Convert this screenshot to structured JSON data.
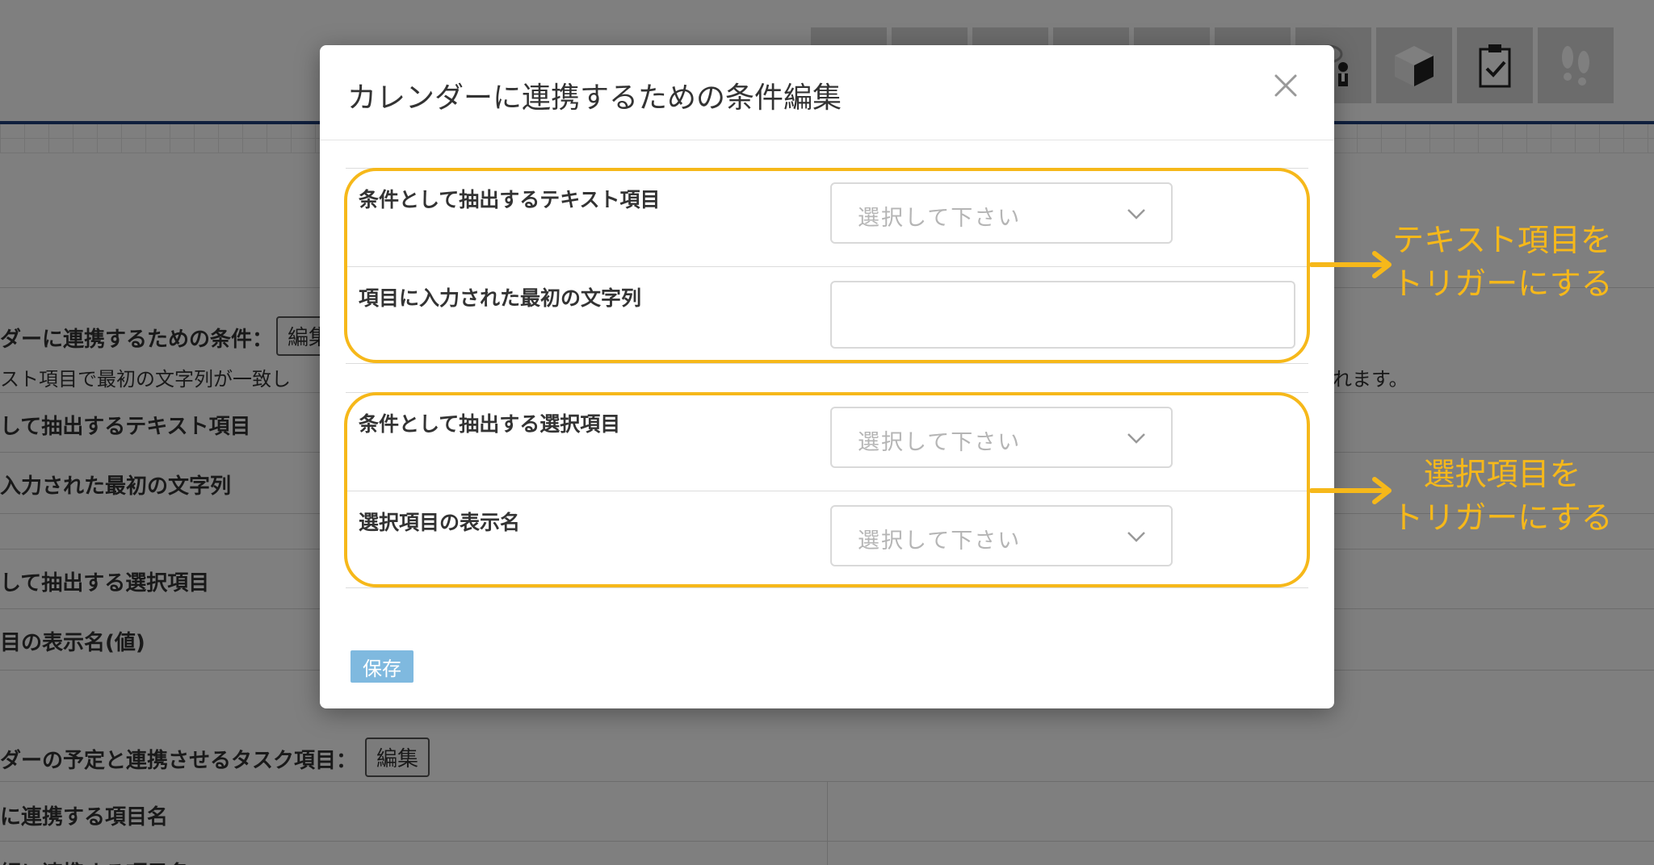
{
  "background": {
    "condition_label": "ダーに連携するための条件：",
    "edit_button": "編集",
    "description_left": "スト項目で最初の文字列が一致し",
    "description_right": "れます。",
    "rows": [
      "して抽出するテキスト項目",
      "入力された最初の文字列",
      "して抽出する選択項目",
      "目の表示名(値)"
    ],
    "task_label": "ダーの予定と連携させるタスク項目：",
    "task_edit_button": "編集",
    "task_rows": [
      "に連携する項目名",
      "細に連携する項目名"
    ]
  },
  "modal": {
    "title": "カレンダーに連携するための条件編集",
    "fields": [
      {
        "label": "条件として抽出するテキスト項目",
        "placeholder": "選択して下さい"
      },
      {
        "label": "項目に入力された最初の文字列",
        "value": ""
      },
      {
        "label": "条件として抽出する選択項目",
        "placeholder": "選択して下さい"
      },
      {
        "label": "選択項目の表示名",
        "placeholder": "選択して下さい"
      }
    ],
    "save_label": "保存"
  },
  "annotations": {
    "text_trigger": [
      "テキスト項目を",
      "トリガーにする"
    ],
    "select_trigger": [
      "選択項目を",
      "トリガーにする"
    ]
  },
  "colors": {
    "highlight": "#f6b81a",
    "save_button": "#7fb9df",
    "header_rule": "#1f3f7a"
  },
  "icons": [
    "gear-icon",
    "chart-icon",
    "document-icon",
    "folder-icon",
    "list-icon",
    "person-icon",
    "chat-user-icon",
    "box-icon",
    "clipboard-check-icon",
    "footprints-icon"
  ]
}
